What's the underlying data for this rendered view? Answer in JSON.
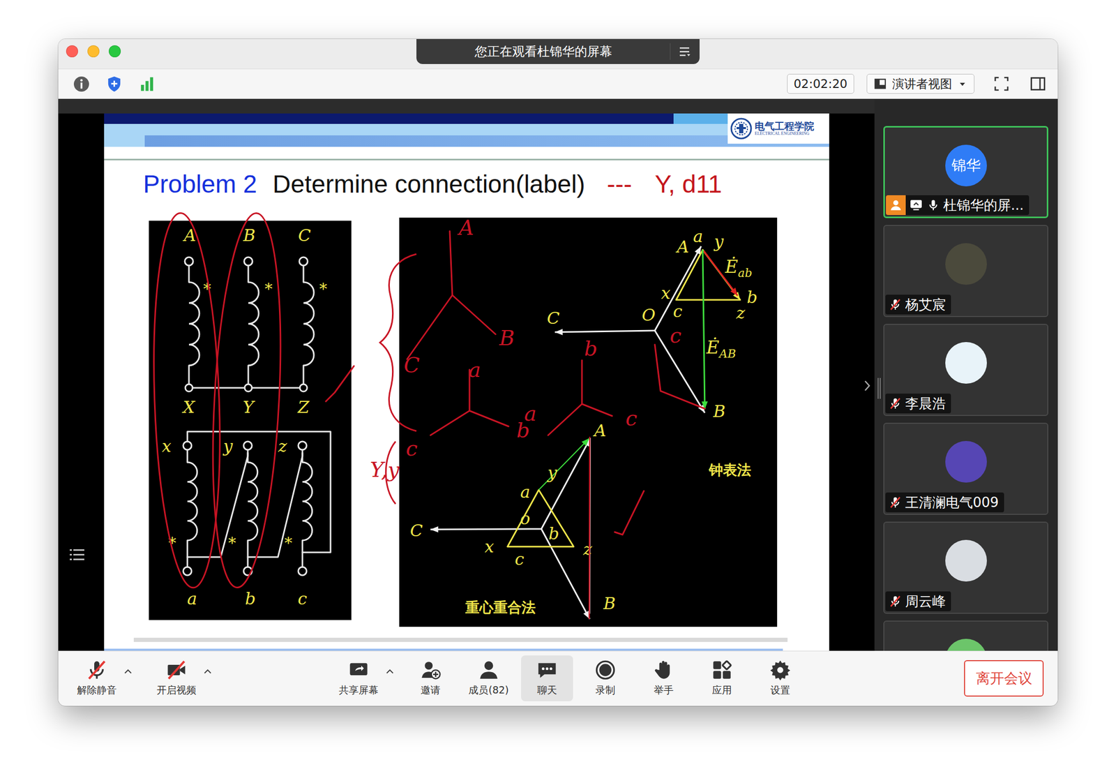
{
  "window": {
    "title": "您正在观看杜锦华的屏幕"
  },
  "toolbar": {
    "time": "02:02:20",
    "view_mode": "演讲者视图"
  },
  "slide": {
    "logo": {
      "name": "电气工程学院",
      "subtitle": "ELECTRICAL ENGINEERING"
    },
    "title": {
      "problem": "Problem 2",
      "text": "Determine connection(label)",
      "dash": "---",
      "answer": "Y, d11"
    },
    "winding": {
      "primary_top": [
        "A",
        "B",
        "C"
      ],
      "primary_bottom": [
        "X",
        "Y",
        "Z"
      ],
      "secondary_top": [
        "x",
        "y",
        "z"
      ],
      "secondary_bottom": [
        "a",
        "b",
        "c"
      ],
      "star": "*"
    },
    "clock_method": {
      "labels": [
        "A",
        "a",
        "y",
        "b",
        "x",
        "c",
        "z",
        "O",
        "C",
        "B"
      ],
      "e_ab": {
        "symbol": "Ė",
        "sub": "ab"
      },
      "e_AB": {
        "symbol": "Ė",
        "sub": "AB"
      },
      "caption": "钟表法"
    },
    "centroid_method": {
      "labels": [
        "a",
        "y",
        "o",
        "b",
        "C",
        "x",
        "c",
        "z",
        "A",
        "B"
      ],
      "caption": "重心重合法"
    },
    "annotations": [
      "A",
      "B",
      "C",
      "a",
      "b",
      "b",
      "a",
      "c",
      "c",
      "c",
      "Y,y"
    ]
  },
  "participants": [
    {
      "name": "杜锦华的屏...",
      "avatar": "锦华",
      "kind": "initials",
      "muted": false,
      "selected": true
    },
    {
      "name": "杨艾宸",
      "kind": "photo",
      "muted": true,
      "selected": false
    },
    {
      "name": "李晨浩",
      "kind": "photo",
      "muted": true,
      "selected": false
    },
    {
      "name": "王清澜电气009",
      "kind": "photo",
      "muted": true,
      "selected": false
    },
    {
      "name": "周云峰",
      "kind": "photo",
      "muted": true,
      "selected": false
    }
  ],
  "controls": [
    {
      "label": "解除静音",
      "has_menu": true,
      "off": true,
      "selected": false
    },
    {
      "label": "开启视频",
      "has_menu": true,
      "off": true,
      "selected": false
    },
    {
      "label": "共享屏幕",
      "has_menu": true,
      "off": false,
      "selected": false
    },
    {
      "label": "邀请",
      "has_menu": false,
      "off": false,
      "selected": false
    },
    {
      "label": "成员(82)",
      "has_menu": false,
      "off": false,
      "selected": false
    },
    {
      "label": "聊天",
      "has_menu": false,
      "off": false,
      "selected": true
    },
    {
      "label": "录制",
      "has_menu": false,
      "off": false,
      "selected": false
    },
    {
      "label": "举手",
      "has_menu": false,
      "off": false,
      "selected": false
    },
    {
      "label": "应用",
      "has_menu": false,
      "off": false,
      "selected": false
    },
    {
      "label": "设置",
      "has_menu": false,
      "off": false,
      "selected": false
    }
  ],
  "leave_button": "离开会议"
}
